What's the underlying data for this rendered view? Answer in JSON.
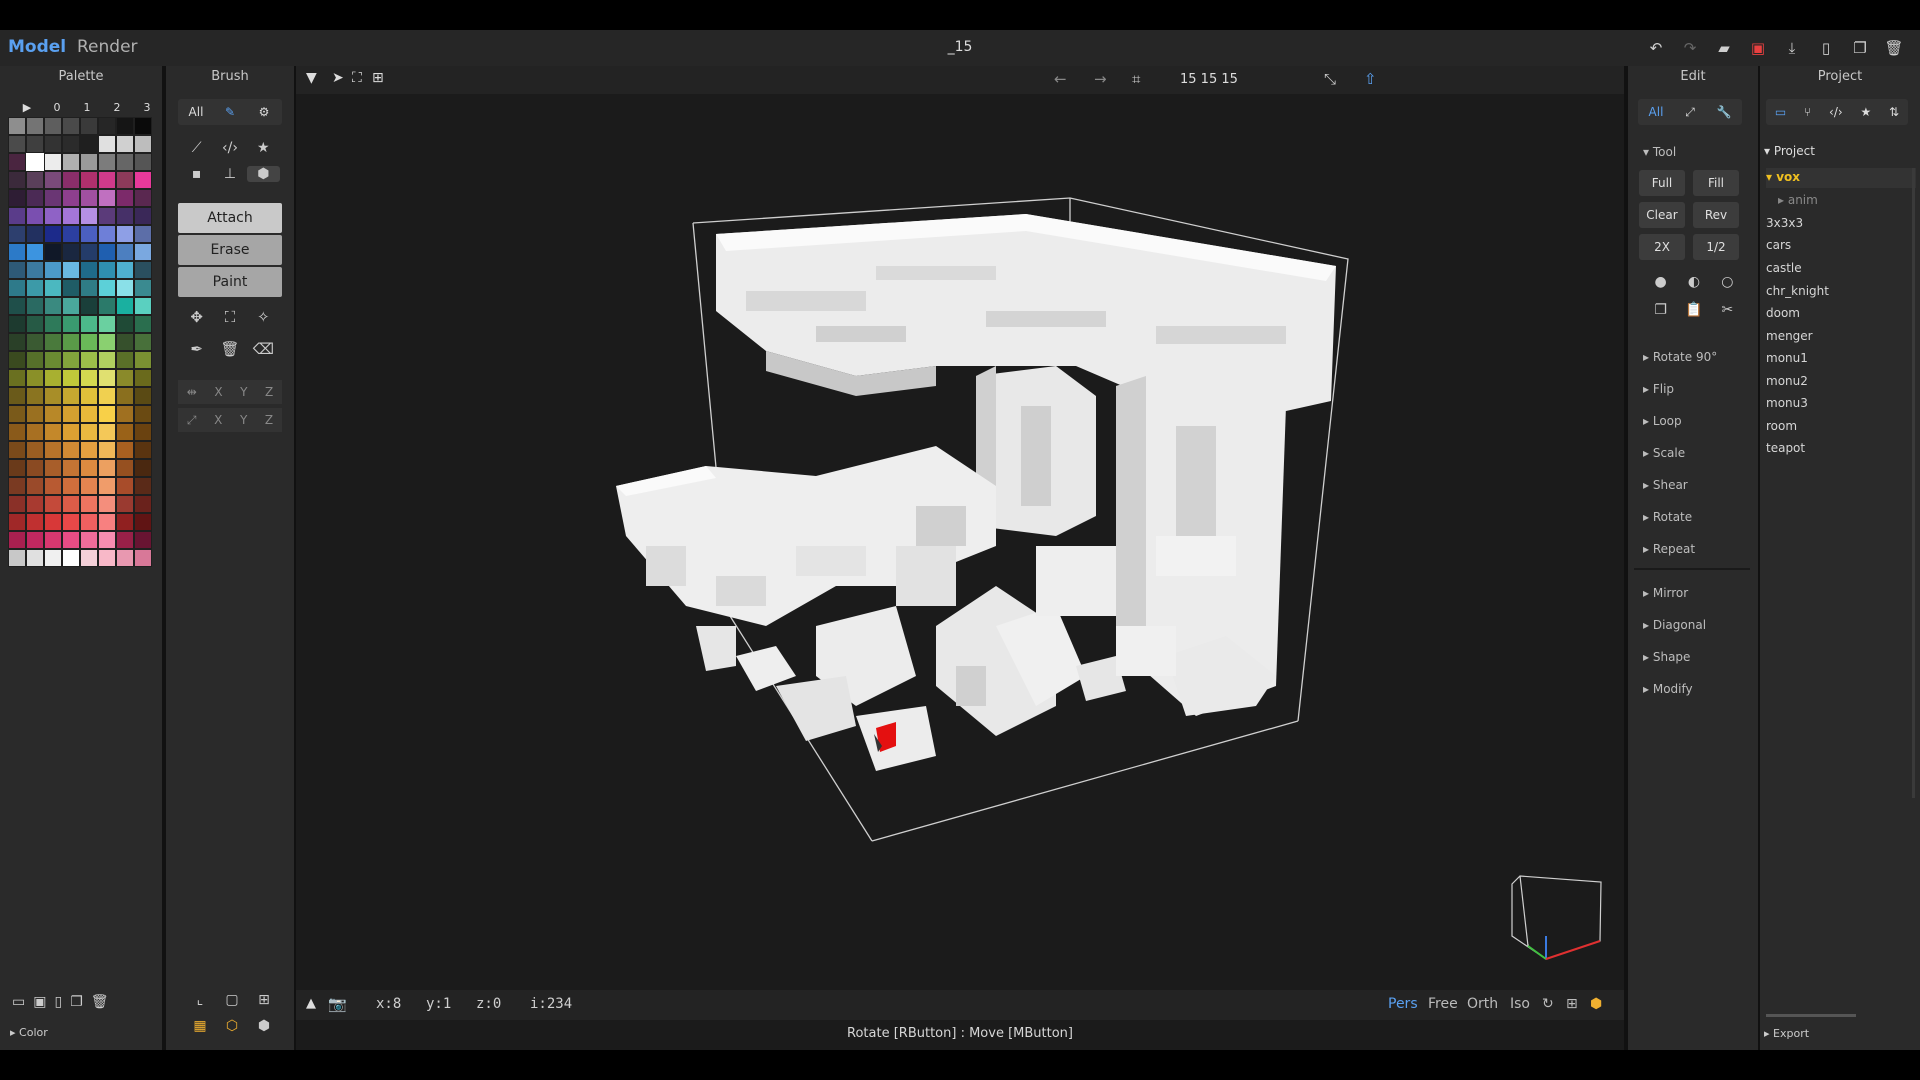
{
  "title": {
    "mode_model": "Model",
    "mode_render": "Render",
    "document": "_15"
  },
  "palette": {
    "title": "Palette",
    "cols": [
      "▶",
      "0",
      "1",
      "2",
      "3"
    ],
    "footer": "Color",
    "swatches": [
      "#8e8e8e",
      "#747474",
      "#5e5e5e",
      "#4a4a4a",
      "#3a3a3a",
      "#262626",
      "#151515",
      "#0a0a0a",
      "#4b4b4b",
      "#3f3f3f",
      "#333333",
      "#2b2b2b",
      "#1f1f1f",
      "#e0e0e0",
      "#d0d0d0",
      "#bdbdbd",
      "#4a2540",
      "#ffffff",
      "#ececec",
      "#b0b0b0",
      "#9a9a9a",
      "#7c7c7c",
      "#666666",
      "#555555",
      "#3b2a3b",
      "#5a3f5a",
      "#7a4a7a",
      "#8a2e6a",
      "#b0306d",
      "#d03a8a",
      "#8c3a5a",
      "#e8399a",
      "#2e1d34",
      "#4b2a55",
      "#6a3674",
      "#8d3f8e",
      "#a050a0",
      "#c070c0",
      "#7c2a6a",
      "#5a2850",
      "#5a3c8a",
      "#7a4fb0",
      "#8f62c6",
      "#a476d8",
      "#b590e4",
      "#5b3b7a",
      "#463068",
      "#3a2858",
      "#2d3f6e",
      "#223060",
      "#1c2a8a",
      "#2c3fa0",
      "#4b5fc0",
      "#6e7fd8",
      "#8e9fe6",
      "#5c6ea8",
      "#2c7ac8",
      "#3c94e0",
      "#101828",
      "#1a2740",
      "#243c6a",
      "#1f5fb0",
      "#4c7fc0",
      "#7aa8e0",
      "#2e5a78",
      "#3c7aa0",
      "#4c9ac8",
      "#6ab8e0",
      "#1f6b8a",
      "#2f8fb0",
      "#4fb0d0",
      "#2a4f5f",
      "#2e7a8a",
      "#3c9aa8",
      "#4bb8c0",
      "#1f5c66",
      "#2f7c86",
      "#5cd0d8",
      "#8ae0e8",
      "#3a8a90",
      "#1f4f4a",
      "#2a6a62",
      "#3a8a80",
      "#4aa89c",
      "#1a3f3a",
      "#2b7a6a",
      "#1ab0a0",
      "#5ad0c0",
      "#1d3a2f",
      "#265a45",
      "#2e7a5a",
      "#3a9a70",
      "#4cb88a",
      "#6ad0a0",
      "#1f4a36",
      "#2a6e4e",
      "#2a4028",
      "#3a5a32",
      "#4a7a3c",
      "#5a9a48",
      "#6ab858",
      "#8ad070",
      "#36502c",
      "#48703a",
      "#3a4a1f",
      "#56702a",
      "#6a8a32",
      "#82a43c",
      "#9cbe4a",
      "#b0d060",
      "#5a7028",
      "#7a9032",
      "#6a7020",
      "#8a9028",
      "#a8b030",
      "#c0c83a",
      "#d4d850",
      "#e0e070",
      "#8a8a2a",
      "#6a6a1c",
      "#6a5a1a",
      "#8a7420",
      "#a88e28",
      "#c6a830",
      "#e0c03a",
      "#f0d050",
      "#8a6f1e",
      "#5a4a14",
      "#7a5a1a",
      "#9a7020",
      "#b88828",
      "#d4a030",
      "#e8b83a",
      "#f8d048",
      "#a07020",
      "#6a4a12",
      "#8a5a1a",
      "#a87022",
      "#c4882a",
      "#dca032",
      "#eab840",
      "#f4c858",
      "#9a6218",
      "#6a4210",
      "#7a4a1a",
      "#9a5e22",
      "#b8742a",
      "#d08a34",
      "#e4a040",
      "#f0b858",
      "#a86020",
      "#5a3410",
      "#6a3a1a",
      "#8a4a22",
      "#a85e2a",
      "#c47434",
      "#dc8a40",
      "#eca060",
      "#965020",
      "#4a2810",
      "#7a3a22",
      "#9a4a2a",
      "#b85a32",
      "#d06e3c",
      "#e48450",
      "#f09c6a",
      "#a84c2a",
      "#5a2a18",
      "#8a3028",
      "#a83a30",
      "#c44a3a",
      "#dc5c48",
      "#ee7460",
      "#f48e7c",
      "#9a3a30",
      "#6a221c",
      "#a02828",
      "#c03030",
      "#d83838",
      "#e84848",
      "#f06060",
      "#f88080",
      "#902020",
      "#601414",
      "#a82050",
      "#c02860",
      "#d83870",
      "#e84c84",
      "#f06c9a",
      "#f88cb0",
      "#982048",
      "#681432",
      "#c8c8c8",
      "#e0e0e0",
      "#f0f0f0",
      "#ffffff",
      "#f4d0d8",
      "#f8b8c8",
      "#e898b0",
      "#d87898"
    ]
  },
  "brush": {
    "title": "Brush",
    "tab_all": "All",
    "modes": [
      "Attach",
      "Erase",
      "Paint"
    ],
    "axes": [
      "X",
      "Y",
      "Z"
    ]
  },
  "viewport": {
    "size": "15 15 15",
    "coords": {
      "x": "x:8",
      "y": "y:1",
      "z": "z:0",
      "i": "i:234"
    },
    "view_modes": [
      "Pers",
      "Free",
      "Orth",
      "Iso"
    ],
    "hint": "Rotate [RButton] : Move [MButton]"
  },
  "edit": {
    "title": "Edit",
    "tab_all": "All",
    "tool_label": "Tool",
    "buttons": [
      "Full",
      "Fill",
      "Clear",
      "Rev",
      "2X",
      "1/2"
    ],
    "sections": [
      "Rotate 90°",
      "Flip",
      "Loop",
      "Scale",
      "Shear",
      "Rotate",
      "Repeat",
      "Mirror",
      "Diagonal",
      "Shape",
      "Modify"
    ]
  },
  "project": {
    "title": "Project",
    "root": "Project",
    "folder": "vox",
    "subfolder": "anim",
    "items": [
      "3x3x3",
      "cars",
      "castle",
      "chr_knight",
      "doom",
      "menger",
      "monu1",
      "monu2",
      "monu3",
      "room",
      "teapot"
    ],
    "footer": "Export"
  }
}
